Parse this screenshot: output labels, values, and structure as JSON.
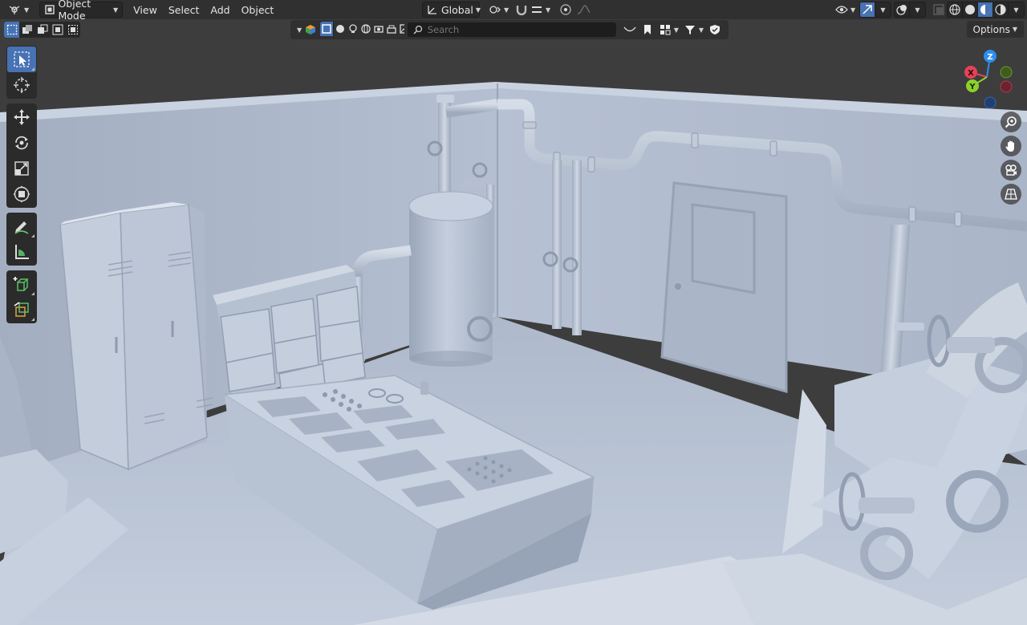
{
  "header": {
    "mode": "Object Mode",
    "menus": [
      "View",
      "Select",
      "Add",
      "Object"
    ],
    "transform_orientation": "Global"
  },
  "filter": {
    "search_placeholder": "Search"
  },
  "options_label": "Options",
  "gizmo": {
    "z": "Z",
    "x": "X",
    "y": "Y",
    "colors": {
      "x": "#e64256",
      "y": "#8bd22e",
      "z": "#2c8ff0"
    }
  },
  "toolbar": {
    "tools": [
      "select-box",
      "cursor",
      "move",
      "rotate",
      "scale",
      "transform",
      "annotate",
      "measure",
      "add-cube",
      "add-geometry"
    ]
  },
  "colors": {
    "accent": "#4772b3",
    "header": "#303030",
    "viewport_bg": "#3d3d3d",
    "model": "#b9c4d6"
  }
}
